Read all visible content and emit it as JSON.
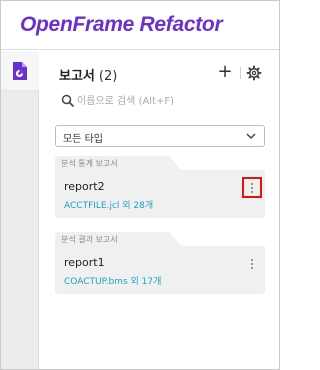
{
  "header": {
    "logo_text": "OpenFrame Refactor",
    "logo_color": "#6b2fd6"
  },
  "rail": {
    "items": [
      {
        "icon": "report-document-icon",
        "active": true
      }
    ]
  },
  "panel": {
    "title": "보고서",
    "count": "(2)",
    "add_label": "+",
    "search": {
      "placeholder": "이름으로 검색 (Alt+F)",
      "value": ""
    },
    "filter": {
      "selected": "모든 타입"
    },
    "reports": [
      {
        "category": "분석 통계 보고서",
        "name": "report2",
        "subtitle": "ACCTFILE.jcl 외 28개",
        "menu_highlighted": true
      },
      {
        "category": "분석 결과 보고서",
        "name": "report1",
        "subtitle": "COACTUP.bms 외 17개",
        "menu_highlighted": false
      }
    ]
  },
  "colors": {
    "accent": "#6b2fd6",
    "link": "#1aa3c8",
    "highlight": "#e01414",
    "card_bg": "#f0f0f0"
  }
}
